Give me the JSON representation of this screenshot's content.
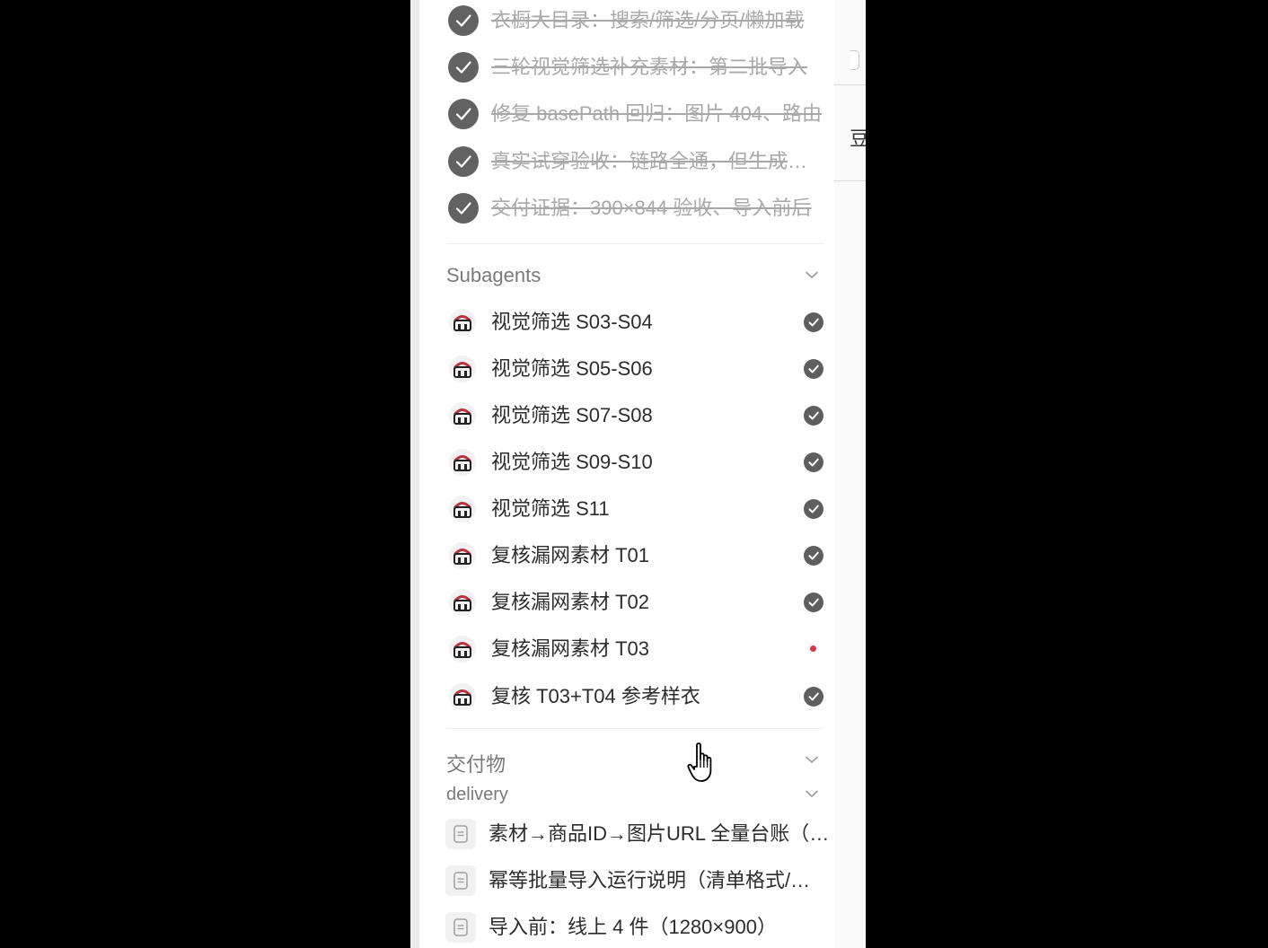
{
  "todos": [
    {
      "text": "衣橱大目录：搜索/筛选/分页/懒加载",
      "done": true
    },
    {
      "text": "三轮视觉筛选补充素材：第二批导入",
      "done": true
    },
    {
      "text": "修复 basePath 回归：图片 404、路由",
      "done": true
    },
    {
      "text": "真实试穿验收：链路全通，但生成结果",
      "done": true
    },
    {
      "text": "交付证据：390×844 验收、导入前后",
      "done": true
    }
  ],
  "subagents": {
    "title": "Subagents",
    "items": [
      {
        "label": "视觉筛选 S03-S04",
        "status": "done"
      },
      {
        "label": "视觉筛选 S05-S06",
        "status": "done"
      },
      {
        "label": "视觉筛选 S07-S08",
        "status": "done"
      },
      {
        "label": "视觉筛选 S09-S10",
        "status": "done"
      },
      {
        "label": "视觉筛选 S11",
        "status": "done"
      },
      {
        "label": "复核漏网素材 T01",
        "status": "done"
      },
      {
        "label": "复核漏网素材 T02",
        "status": "done"
      },
      {
        "label": "复核漏网素材 T03",
        "status": "running"
      },
      {
        "label": "复核 T03+T04 参考样衣",
        "status": "done"
      }
    ]
  },
  "deliverables": {
    "title": "交付物",
    "group": "delivery",
    "files": [
      "素材→商品ID→图片URL 全量台账（CSV）",
      "幂等批量导入运行说明（清单格式/参数）",
      "导入前：线上 4 件（1280×900）"
    ]
  },
  "background": {
    "glyph": "豆"
  },
  "colors": {
    "running": "#d63a4a",
    "done": "#5f5f5f"
  }
}
